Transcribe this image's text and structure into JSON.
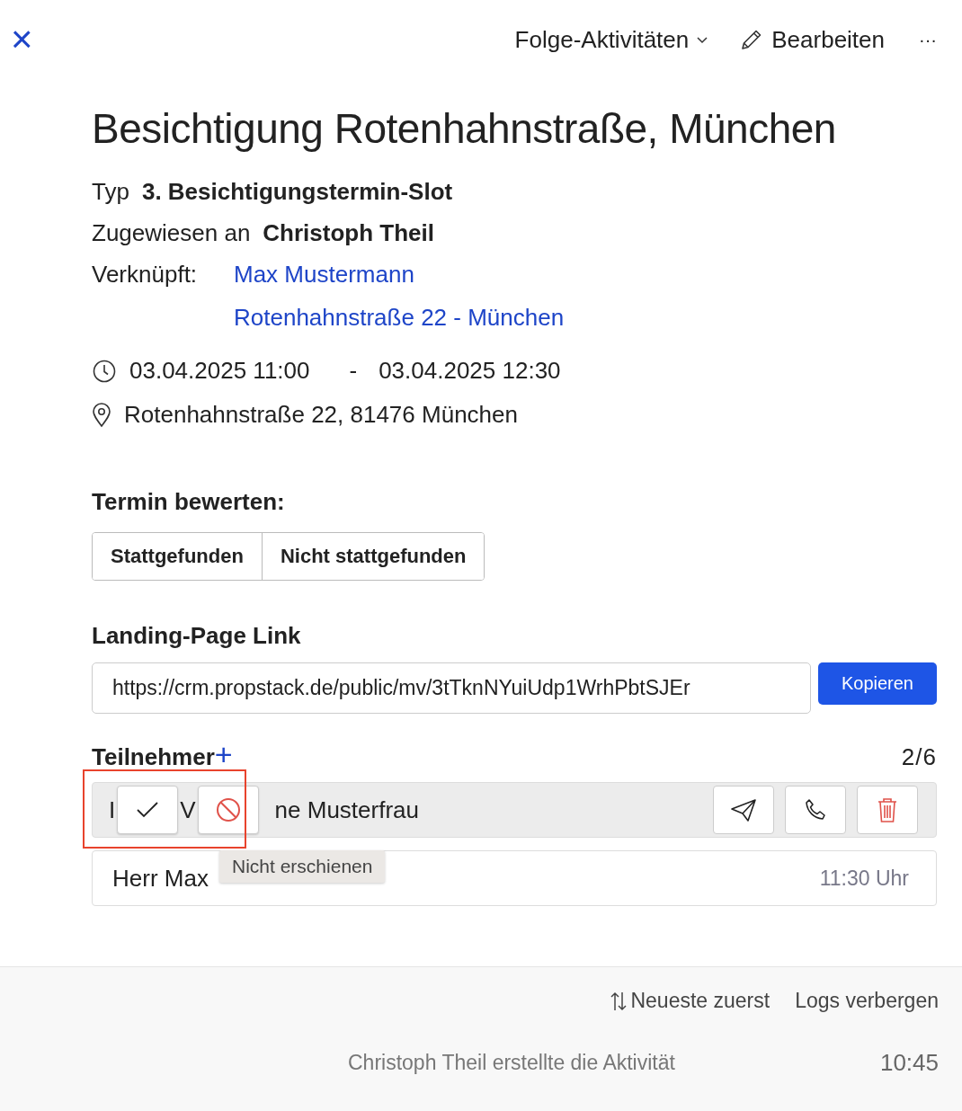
{
  "toolbar": {
    "close": "×",
    "follow_up": "Folge-Aktivitäten",
    "edit": "Bearbeiten",
    "more": "···"
  },
  "title": "Besichtigung Rotenhahnstraße, München",
  "details": [
    {
      "label": "Typ",
      "value": "3. Besichtigungstermin-Slot"
    },
    {
      "label": "Zugewiesen an",
      "value": "Christoph Theil"
    }
  ],
  "linked": {
    "label": "Verknüpft:",
    "links": [
      "Max Mustermann",
      "Rotenhahnstraße 22 - München"
    ]
  },
  "time": {
    "start": "03.04.2025 11:00",
    "separator": "-",
    "end": "03.04.2025 12:30"
  },
  "location": "Rotenhahnstraße 22, 81476 München",
  "rating": {
    "heading": "Termin bewerten:",
    "options": [
      {
        "label": "Stattgefunden",
        "selected": false
      },
      {
        "label": "Nicht stattgefunden",
        "selected": false
      }
    ]
  },
  "landing": {
    "heading": "Landing-Page Link",
    "url": "https://crm.propstack.de/public/mv/3tTknNYuiUdp1WrhPbtSJEr",
    "button": "Kopieren"
  },
  "participants": {
    "heading": "Teilnehmer",
    "add": "+",
    "count": "2/6",
    "rows": [
      {
        "hovered": true,
        "name_parts": [
          "I",
          "V",
          "ne Musterfrau"
        ]
      },
      {
        "hovered": false,
        "name_parts": [
          "Herr Max"
        ],
        "time": "11:30 Uhr"
      }
    ],
    "tooltip": "Nicht erschienen"
  },
  "footer": {
    "sort": "Neueste zuerst",
    "logs": "Logs verbergen",
    "entry": "Christoph Theil erstellte die Aktivität",
    "entry_time": "10:45"
  }
}
